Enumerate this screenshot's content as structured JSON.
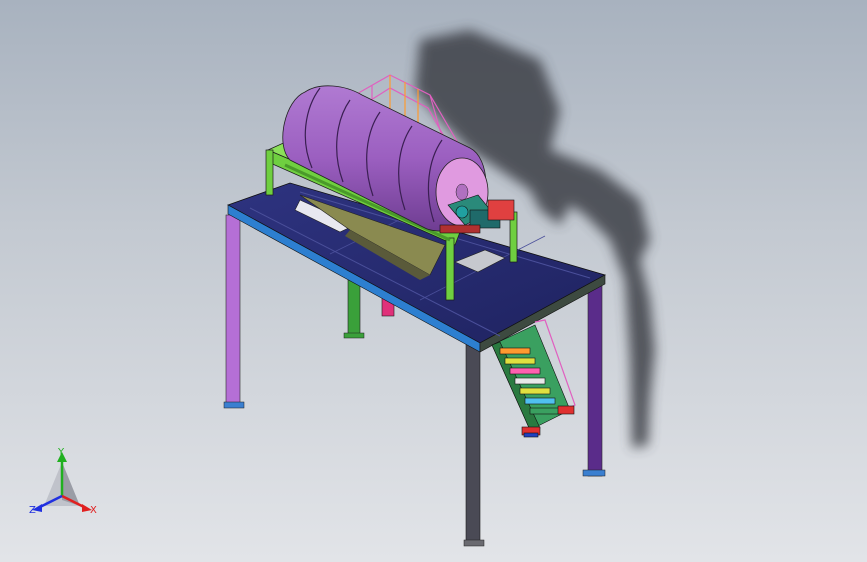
{
  "viewport": {
    "background_top": "#a8b2bf",
    "background_bottom": "#e2e4e8"
  },
  "model": {
    "drum_color": "#9b5fc0",
    "platform_color": "#262a6e",
    "shadow_color": "#3d4147"
  },
  "triad": {
    "x_label": "X",
    "y_label": "Y",
    "z_label": "Z",
    "x_color": "#e02020",
    "y_color": "#20b020",
    "z_color": "#2030e0"
  }
}
